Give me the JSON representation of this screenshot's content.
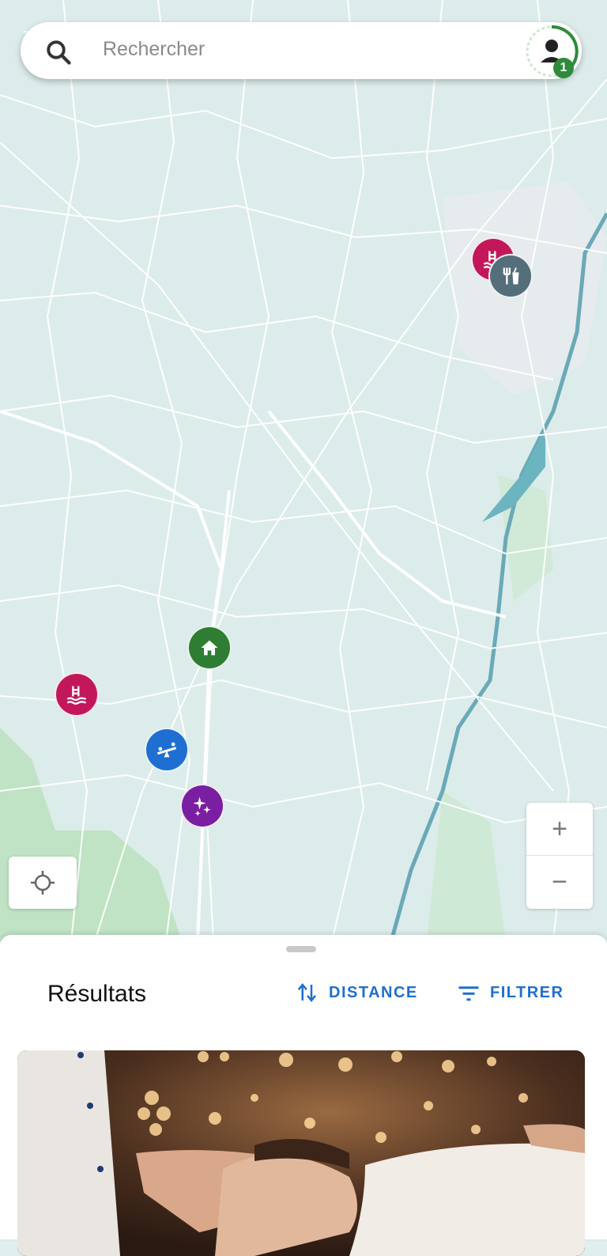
{
  "search": {
    "placeholder": "Rechercher",
    "icon": "search-icon"
  },
  "profile": {
    "icon": "user-icon",
    "notification_count": "1",
    "badge_color": "#2e8b3a"
  },
  "map": {
    "pins": [
      {
        "name": "pin-swimming-pool",
        "icon": "pool-icon",
        "color": "#c2185b"
      },
      {
        "name": "pin-restaurant",
        "icon": "restaurant-icon",
        "color": "#546e7a"
      },
      {
        "name": "pin-home",
        "icon": "home-icon",
        "color": "#2e7d32"
      },
      {
        "name": "pin-swimming-pool",
        "icon": "pool-icon",
        "color": "#c2185b"
      },
      {
        "name": "pin-playground",
        "icon": "seesaw-icon",
        "color": "#1e6fd1"
      },
      {
        "name": "pin-wellness",
        "icon": "sparkles-icon",
        "color": "#7b1fa2"
      }
    ],
    "zoom_in_label": "+",
    "zoom_out_label": "−",
    "locate_icon": "crosshair-icon"
  },
  "results": {
    "title": "Résultats",
    "sort_label": "DISTANCE",
    "filter_label": "FILTRER",
    "accent_color": "#1e6fd1",
    "first_card_image": "spa-massage-photo"
  }
}
